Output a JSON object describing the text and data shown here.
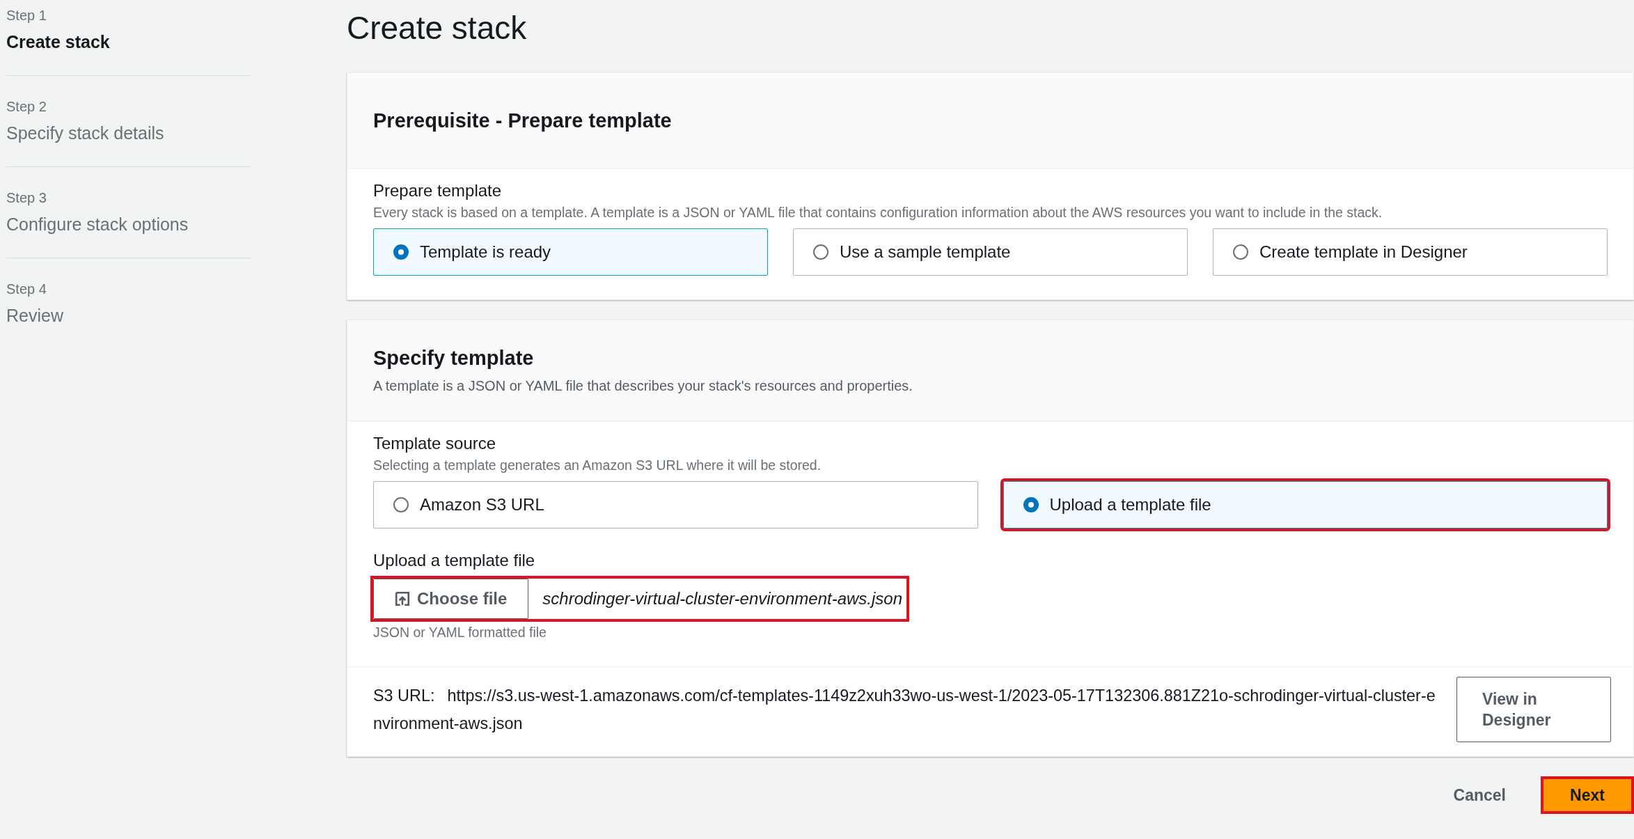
{
  "steps": [
    {
      "label": "Step 1",
      "title": "Create stack",
      "selected": true
    },
    {
      "label": "Step 2",
      "title": "Specify stack details",
      "selected": false
    },
    {
      "label": "Step 3",
      "title": "Configure stack options",
      "selected": false
    },
    {
      "label": "Step 4",
      "title": "Review",
      "selected": false
    }
  ],
  "page_title": "Create stack",
  "prerequisite": {
    "heading": "Prerequisite - Prepare template",
    "field_label": "Prepare template",
    "description": "Every stack is based on a template. A template is a JSON or YAML file that contains configuration information about the AWS resources you want to include in the stack.",
    "options": [
      {
        "label": "Template is ready",
        "selected": true,
        "highlighted": false
      },
      {
        "label": "Use a sample template",
        "selected": false,
        "highlighted": false
      },
      {
        "label": "Create template in Designer",
        "selected": false,
        "highlighted": false
      }
    ]
  },
  "specify": {
    "heading": "Specify template",
    "subheading": "A template is a JSON or YAML file that describes your stack's resources and properties.",
    "field_label": "Template source",
    "description": "Selecting a template generates an Amazon S3 URL where it will be stored.",
    "options": [
      {
        "label": "Amazon S3 URL",
        "selected": false,
        "highlighted": false
      },
      {
        "label": "Upload a template file",
        "selected": true,
        "highlighted": true
      }
    ],
    "upload": {
      "label": "Upload a template file",
      "button": "Choose file",
      "file_name": "schrodinger-virtual-cluster-environment-aws.json",
      "hint": "JSON or YAML formatted file",
      "highlighted": true
    },
    "s3_label": "S3 URL:",
    "s3_url": "https://s3.us-west-1.amazonaws.com/cf-templates-1149z2xuh33wo-us-west-1/2023-05-17T132306.881Z21o-schrodinger-virtual-cluster-environment-aws.json",
    "designer_button": "View in Designer"
  },
  "actions": [
    {
      "label": "Cancel",
      "kind": "link",
      "highlighted": false
    },
    {
      "label": "Next",
      "kind": "primary",
      "highlighted": true
    }
  ]
}
